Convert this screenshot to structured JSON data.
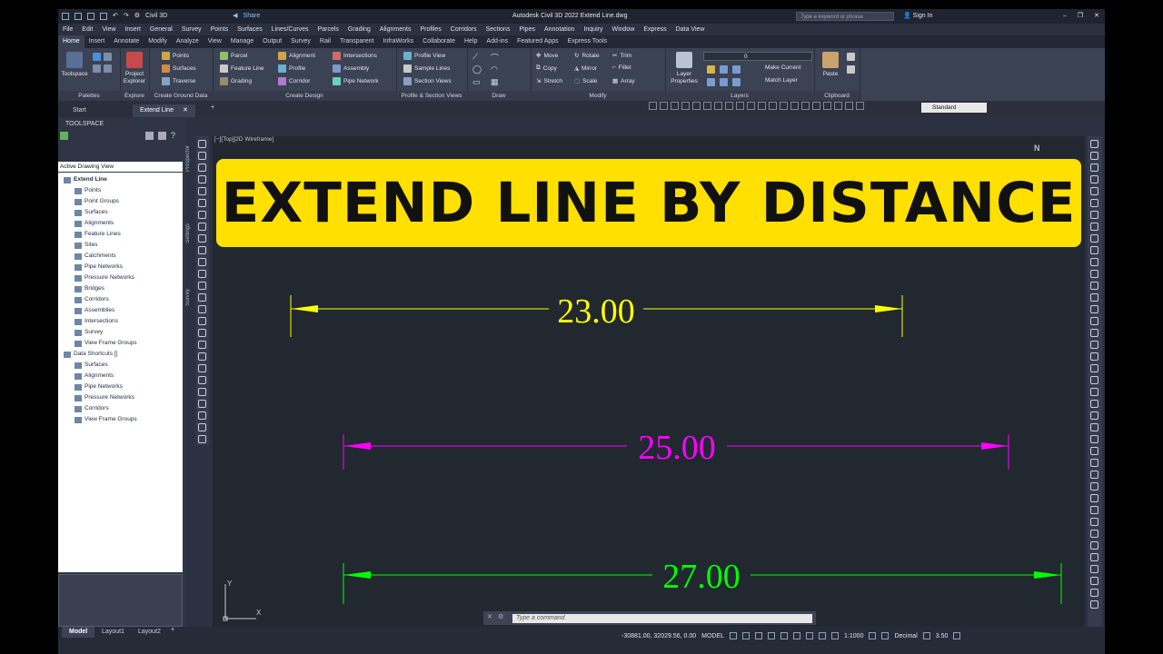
{
  "titlebar": {
    "workspace": "Civil 3D",
    "share": "Share",
    "title": "Autodesk Civil 3D 2022    Extend Line.dwg",
    "search_placeholder": "Type a keyword or phrase",
    "sign_in": "Sign In"
  },
  "menu": [
    "File",
    "Edit",
    "View",
    "Insert",
    "General",
    "Survey",
    "Points",
    "Surfaces",
    "Lines/Curves",
    "Parcels",
    "Grading",
    "Alignments",
    "Profiles",
    "Corridors",
    "Sections",
    "Pipes",
    "Annotation",
    "Inquiry",
    "Window",
    "Express",
    "Data View"
  ],
  "ribbon_tabs": [
    "Home",
    "Insert",
    "Annotate",
    "Modify",
    "Analyze",
    "View",
    "Manage",
    "Output",
    "Survey",
    "Rail",
    "Transparent",
    "InfraWorks",
    "Collaborate",
    "Help",
    "Add-ins",
    "Featured Apps",
    "Express Tools"
  ],
  "ribbon": {
    "toolspace": "Toolspace",
    "project_explorer": "Project Explorer",
    "palettes": "Palettes",
    "explore": "Explore",
    "points": "Points",
    "surfaces": "Surfaces",
    "traverse": "Traverse",
    "create_ground_data": "Create Ground Data",
    "parcel": "Parcel",
    "feature_line": "Feature Line",
    "grading": "Grading",
    "alignment": "Alignment",
    "profile": "Profile",
    "corridor": "Corridor",
    "intersections": "Intersections",
    "assembly": "Assembly",
    "pipe_network": "Pipe Network",
    "create_design": "Create Design",
    "profile_view": "Profile View",
    "sample_lines": "Sample Lines",
    "section_views": "Section Views",
    "profile_section_views": "Profile & Section Views",
    "draw": "Draw",
    "move": "Move",
    "copy": "Copy",
    "stretch": "Stretch",
    "rotate": "Rotate",
    "mirror": "Mirror",
    "scale": "Scale",
    "trim": "Trim",
    "fillet": "Fillet",
    "array": "Array",
    "modify": "Modify",
    "layer_properties": "Layer Properties",
    "layer_value": "0",
    "make_current": "Make Current",
    "match_layer": "Match Layer",
    "layers": "Layers",
    "paste": "Paste",
    "clipboard": "Clipboard"
  },
  "doc_tabs": {
    "start": "Start",
    "active": "Extend Line"
  },
  "text_style": "Standard",
  "toolspace": {
    "header": "TOOLSPACE",
    "view_select": "Active Drawing View",
    "side_tabs": [
      "Prospector",
      "Settings",
      "Survey"
    ],
    "tree": [
      {
        "label": "Extend Line",
        "level": 0,
        "bold": true
      },
      {
        "label": "Points",
        "level": 1
      },
      {
        "label": "Point Groups",
        "level": 1
      },
      {
        "label": "Surfaces",
        "level": 1
      },
      {
        "label": "Alignments",
        "level": 1
      },
      {
        "label": "Feature Lines",
        "level": 1
      },
      {
        "label": "Sites",
        "level": 1
      },
      {
        "label": "Catchments",
        "level": 1
      },
      {
        "label": "Pipe Networks",
        "level": 1
      },
      {
        "label": "Pressure Networks",
        "level": 1
      },
      {
        "label": "Bridges",
        "level": 1
      },
      {
        "label": "Corridors",
        "level": 1
      },
      {
        "label": "Assemblies",
        "level": 1
      },
      {
        "label": "Intersections",
        "level": 1
      },
      {
        "label": "Survey",
        "level": 1
      },
      {
        "label": "View Frame Groups",
        "level": 1
      },
      {
        "label": "Data Shortcuts []",
        "level": 0
      },
      {
        "label": "Surfaces",
        "level": 1
      },
      {
        "label": "Alignments",
        "level": 1
      },
      {
        "label": "Pipe Networks",
        "level": 1
      },
      {
        "label": "Pressure Networks",
        "level": 1
      },
      {
        "label": "Corridors",
        "level": 1
      },
      {
        "label": "View Frame Groups",
        "level": 1
      }
    ]
  },
  "viewport": {
    "label": "[−][Top][2D Wireframe]",
    "compass": "N",
    "banner": "EXTEND LINE BY DISTANCE"
  },
  "dimensions": [
    {
      "value": "23.00",
      "color": "#ffff00"
    },
    {
      "value": "25.00",
      "color": "#ff00ff"
    },
    {
      "value": "27.00",
      "color": "#00ff00"
    }
  ],
  "command_placeholder": "Type a command",
  "layout_tabs": [
    "Model",
    "Layout1",
    "Layout2"
  ],
  "status": {
    "coords": "-30881.00, 32029.56, 0.00",
    "model": "MODEL",
    "scale": "1:1000",
    "units": "Decimal",
    "annotation_value": "3.50"
  }
}
